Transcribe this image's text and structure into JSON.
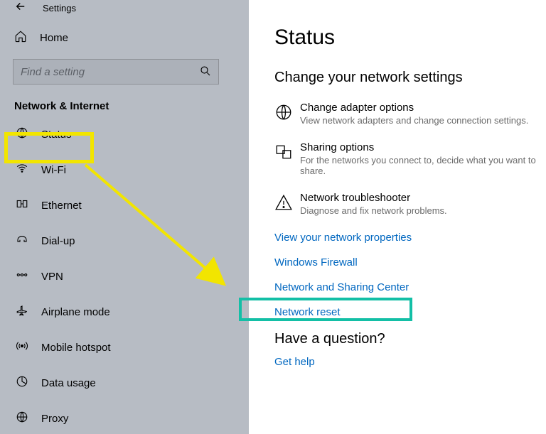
{
  "window": {
    "title": "Settings"
  },
  "sidebar": {
    "home_label": "Home",
    "search_placeholder": "Find a setting",
    "section_header": "Network & Internet",
    "items": [
      {
        "label": "Status"
      },
      {
        "label": "Wi-Fi"
      },
      {
        "label": "Ethernet"
      },
      {
        "label": "Dial-up"
      },
      {
        "label": "VPN"
      },
      {
        "label": "Airplane mode"
      },
      {
        "label": "Mobile hotspot"
      },
      {
        "label": "Data usage"
      },
      {
        "label": "Proxy"
      }
    ]
  },
  "main": {
    "title": "Status",
    "subhead": "Change your network settings",
    "options": [
      {
        "title": "Change adapter options",
        "desc": "View network adapters and change connection settings."
      },
      {
        "title": "Sharing options",
        "desc": "For the networks you connect to, decide what you want to share."
      },
      {
        "title": "Network troubleshooter",
        "desc": "Diagnose and fix network problems."
      }
    ],
    "links": [
      {
        "text": "View your network properties"
      },
      {
        "text": "Windows Firewall"
      },
      {
        "text": "Network and Sharing Center"
      },
      {
        "text": "Network reset"
      }
    ],
    "question_head": "Have a question?",
    "help_link": "Get help"
  }
}
